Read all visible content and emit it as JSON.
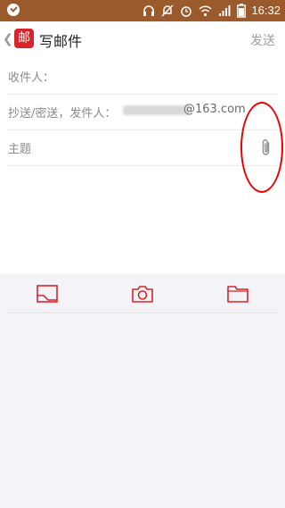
{
  "status": {
    "time": "16:32"
  },
  "header": {
    "logo_text": "邮",
    "title": "写邮件",
    "send_label": "发送"
  },
  "form": {
    "to_label": "收件人：",
    "cc_label": "抄送/密送，发件人：",
    "email_domain": "@163.com",
    "subject_label": "主题"
  },
  "colors": {
    "statusbar": "#9a5a2c",
    "accent": "#d8252b",
    "annotation": "#ee0000"
  },
  "icons": {
    "back": "chevron-left-icon",
    "attach": "paperclip-icon",
    "inbox": "inbox-tray-icon",
    "camera": "camera-icon",
    "folder": "folder-icon"
  }
}
